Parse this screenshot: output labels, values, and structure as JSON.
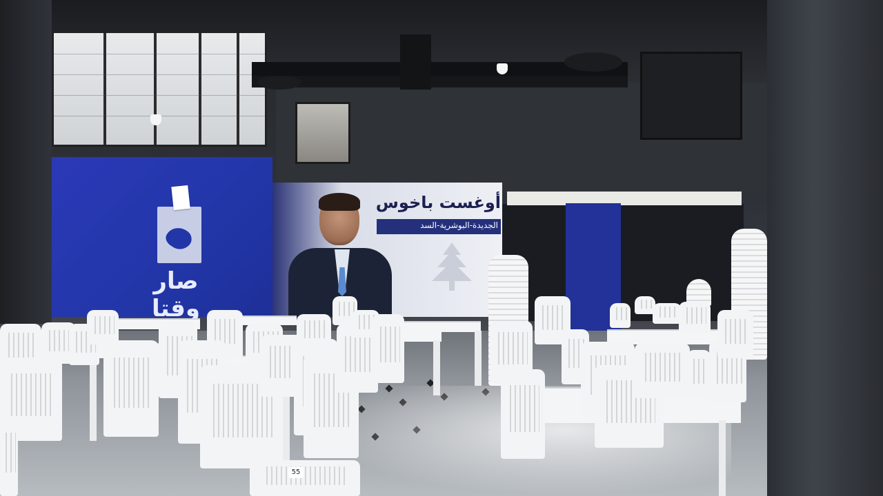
{
  "scene": {
    "banner_brand_name": "صار وقتا",
    "banner_brand_subtitle": "الجديدة",
    "ballot_label": "صار وقتا",
    "candidate_name": "أوغست باخوس",
    "candidate_area": "الجديدة-البوشرية-السد",
    "chair_number": "55"
  },
  "colors": {
    "banner_blue": "#2236a8",
    "banner_white": "#eef0f5",
    "chair_white": "#f3f4f5",
    "wall_dark": "#2f3237"
  },
  "icons": {
    "ballot": "ballot-box-icon",
    "cedar": "cedar-tree-icon"
  }
}
